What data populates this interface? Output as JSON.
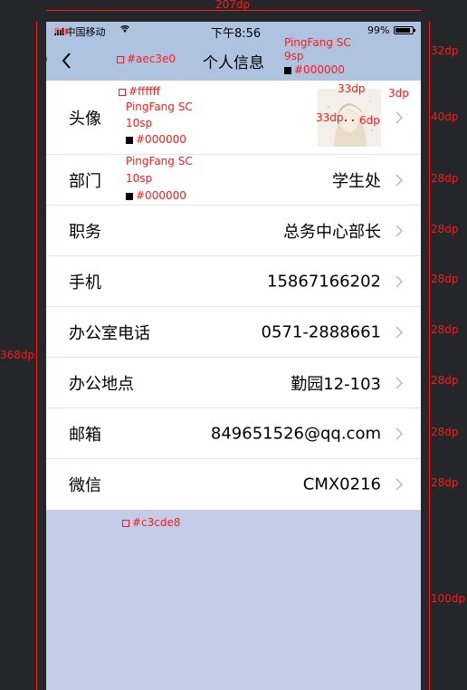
{
  "status_bar": {
    "carrier": "中国移动",
    "signal": ".ııl",
    "wifi": "wifi-icon",
    "time": "下午8:56",
    "battery": "99%"
  },
  "nav": {
    "title": "个人信息",
    "back": "back-chevron-icon"
  },
  "profile": {
    "avatar_label": "头像",
    "rows": [
      {
        "label": "部门",
        "value": "学生处"
      },
      {
        "label": "职务",
        "value": "总务中心部长"
      },
      {
        "label": "手机",
        "value": "15867166202"
      },
      {
        "label": "办公室电话",
        "value": "0571-2888661"
      },
      {
        "label": "办公地点",
        "value": "勤园12-103"
      },
      {
        "label": "邮箱",
        "value": "849651526@qq.com"
      },
      {
        "label": "微信",
        "value": "CMX0216"
      }
    ]
  },
  "colors": {
    "nav_bg": "#aec3e0",
    "list_bg": "#ffffff",
    "page_bg": "#c3cde8",
    "text": "#000000"
  },
  "annotations": {
    "width": "207dp",
    "height": "368dp",
    "status_h": "32dp",
    "row_avatar_h": "40dp",
    "row_h": "28dp",
    "rest_h": "100dp",
    "back_h": "9dp",
    "back_w": "8dp",
    "avatar_w": "33dp",
    "avatar_h": "33dp",
    "chev_gap": "3dp",
    "chev_h": "6dp",
    "nav_bg_label": "#aec3e0",
    "list_bg_label": "#ffffff",
    "page_bg_label": "#c3cde8",
    "title_font": "PingFang SC",
    "title_size": "9sp",
    "title_color": "#000000",
    "label_font_1": "PingFang SC",
    "label_size_1": "10sp",
    "label_color_1": "#000000",
    "label_font_2": "PingFang SC",
    "label_size_2": "10sp",
    "label_color_2": "#000000"
  }
}
